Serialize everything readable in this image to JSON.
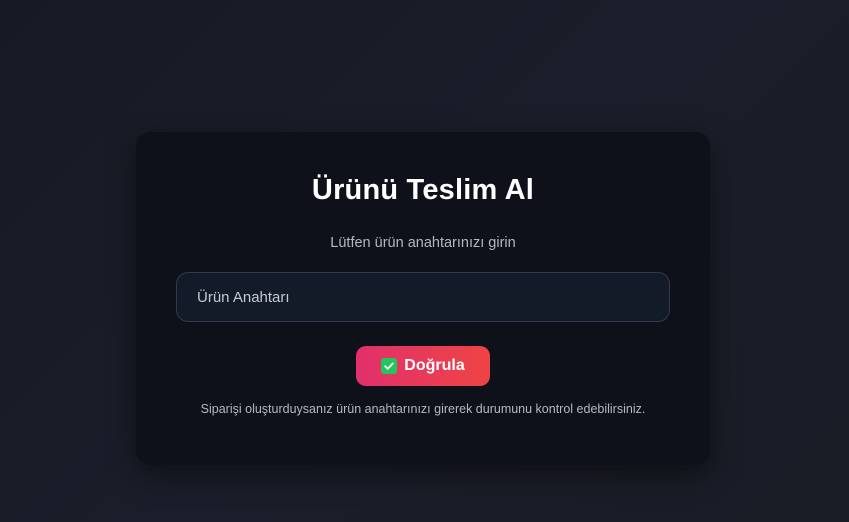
{
  "card": {
    "title": "Ürünü Teslim Al",
    "subtitle": "Lütfen ürün anahtarınızı girin",
    "key_input": {
      "placeholder": "Ürün Anahtarı",
      "value": ""
    },
    "verify_button": {
      "icon": "check-box-icon",
      "label": "Doğrula"
    },
    "note": "Siparişi oluşturduysanız ürün anahtarınızı girerek durumunu kontrol edebilirsiniz."
  },
  "colors": {
    "background": "#1a1c26",
    "card": "#0f111a",
    "input_bg": "#131a28",
    "button_gradient_start": "#e1306c",
    "button_gradient_end": "#ef4444",
    "check_icon": "#22c55e"
  }
}
